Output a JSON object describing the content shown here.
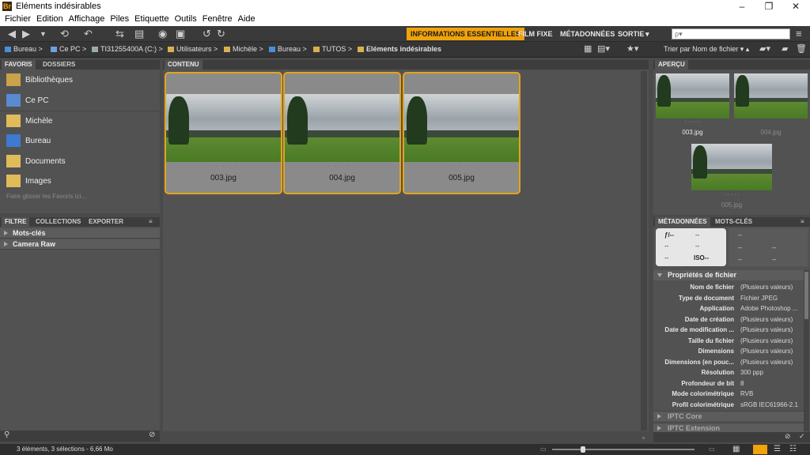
{
  "window": {
    "title": "Eléments indésirables",
    "app_icon": "Br"
  },
  "menu": [
    "Fichier",
    "Edition",
    "Affichage",
    "Piles",
    "Etiquette",
    "Outils",
    "Fenêtre",
    "Aide"
  ],
  "workspaces": {
    "active": "INFORMATIONS ESSENTIELLES",
    "film": "FILM FIXE",
    "meta": "MÉTADONNÉES",
    "out": "SORTIE",
    "more": "▾"
  },
  "search": {
    "placeholder": "ρ▾"
  },
  "path": [
    "Bureau",
    "Ce PC",
    "TI31255400A (C:)",
    "Utilisateurs",
    "Michèle",
    "Bureau",
    "TUTOS",
    "Eléments indésirables"
  ],
  "sort_label": "Trier par Nom de fichier",
  "panels": {
    "favoris": "FAVORIS",
    "dossiers": "DOSSIERS",
    "contenu": "CONTENU",
    "apercu": "APERÇU",
    "filtre": "FILTRE",
    "collections": "COLLECTIONS",
    "exporter": "EXPORTER",
    "metadonnees": "MÉTADONNÉES",
    "motscles": "MOTS-CLÉS"
  },
  "favorites": [
    "Bibliothèques",
    "Ce PC",
    "Michèle",
    "Bureau",
    "Documents",
    "Images"
  ],
  "favorites_hint": "Faire glisser les Favoris ici...",
  "filter_sections": [
    "Mots-clés",
    "Camera Raw"
  ],
  "files": [
    {
      "name": "003.jpg",
      "dots": "· · · · ·"
    },
    {
      "name": "004.jpg",
      "dots": "· · · · ·"
    },
    {
      "name": "005.jpg",
      "dots": "· · · · ·"
    }
  ],
  "preview": {
    "labels": [
      "003.jpg",
      "004.jpg",
      "005.jpg"
    ],
    "dots": "· · · · ·"
  },
  "camera": {
    "f": "ƒ/--",
    "a": "--",
    "b": "--",
    "c": "--",
    "iso": "ISO--",
    "d": "--",
    "e": "--",
    "g": "--",
    "h": "--",
    "i": "--",
    "j": "--"
  },
  "metadata": {
    "section": "Propriétés de fichier",
    "rows": [
      {
        "k": "Nom de fichier",
        "v": "(Plusieurs valeurs)"
      },
      {
        "k": "Type de document",
        "v": "Fichier JPEG"
      },
      {
        "k": "Application",
        "v": "Adobe Photoshop ..."
      },
      {
        "k": "Date de création",
        "v": "(Plusieurs valeurs)"
      },
      {
        "k": "Date de modification ...",
        "v": "(Plusieurs valeurs)"
      },
      {
        "k": "Taille du fichier",
        "v": "(Plusieurs valeurs)"
      },
      {
        "k": "Dimensions",
        "v": "(Plusieurs valeurs)"
      },
      {
        "k": "Dimensions (en pouc...",
        "v": "(Plusieurs valeurs)"
      },
      {
        "k": "Résolution",
        "v": "300 ppp"
      },
      {
        "k": "Profondeur de bit",
        "v": "8"
      },
      {
        "k": "Mode colorimétrique",
        "v": "RVB"
      },
      {
        "k": "Profil colorimétrique",
        "v": "sRGB IEC61966-2.1"
      }
    ],
    "iptc_core": "IPTC Core",
    "iptc_ext": "IPTC Extension"
  },
  "status": "3 éléments, 3 sélections - 6,66 Mo",
  "colors": {
    "accent": "#f0a30a",
    "selection": "#e5a418"
  }
}
